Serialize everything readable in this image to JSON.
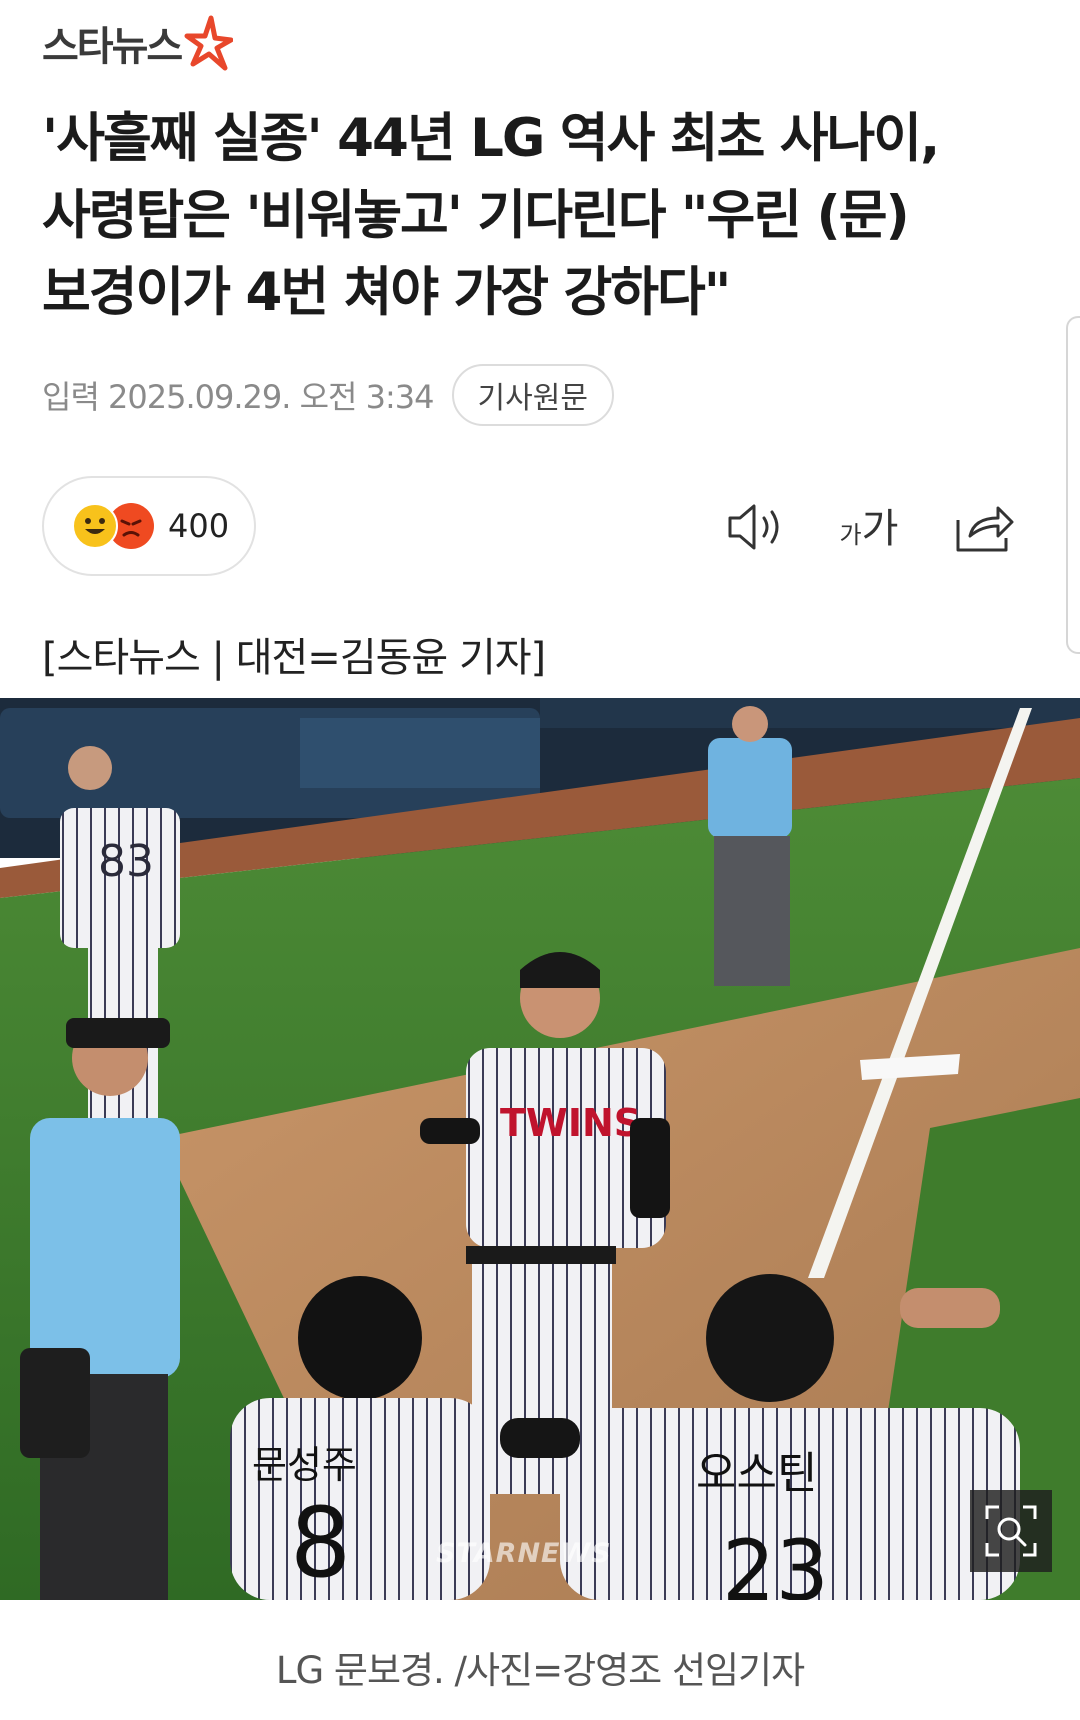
{
  "header": {
    "logo_text": "스타뉴스",
    "logo_star_color": "#e8472b"
  },
  "article": {
    "headline_lines": [
      "'사흘째 실종' 44년 LG 역사 최초 사나이,",
      "사령탑은 '비워놓고' 기다린다 \"우린 (문)",
      "보경이가 4번 쳐야 가장 강하다\""
    ],
    "date": "입력 2025.09.29. 오전 3:34",
    "source_button": "기사원문",
    "reaction_count": "400",
    "byline": "[스타뉴스 | 대전=김동윤 기자]",
    "photo_caption": "LG 문보경. /사진=강영조 선임기자"
  },
  "toolbar": {
    "speaker_icon": "speaker-icon",
    "font_size_icon": "font-size-icon",
    "font_size_glyph_small": "가",
    "font_size_glyph_large": "가",
    "share_icon": "share-icon"
  },
  "photo": {
    "watermark": "STARNEWS",
    "jersey_text": "TWINS",
    "jersey_numbers": [
      "83",
      "8",
      "23"
    ],
    "player_names": [
      "문성주",
      "오스틴"
    ],
    "zoom_icon": "zoom-icon"
  },
  "colors": {
    "accent": "#e8472b",
    "text_meta": "#8a8a8a",
    "turf": "#3f7c2c",
    "dirt": "#b9875b"
  }
}
